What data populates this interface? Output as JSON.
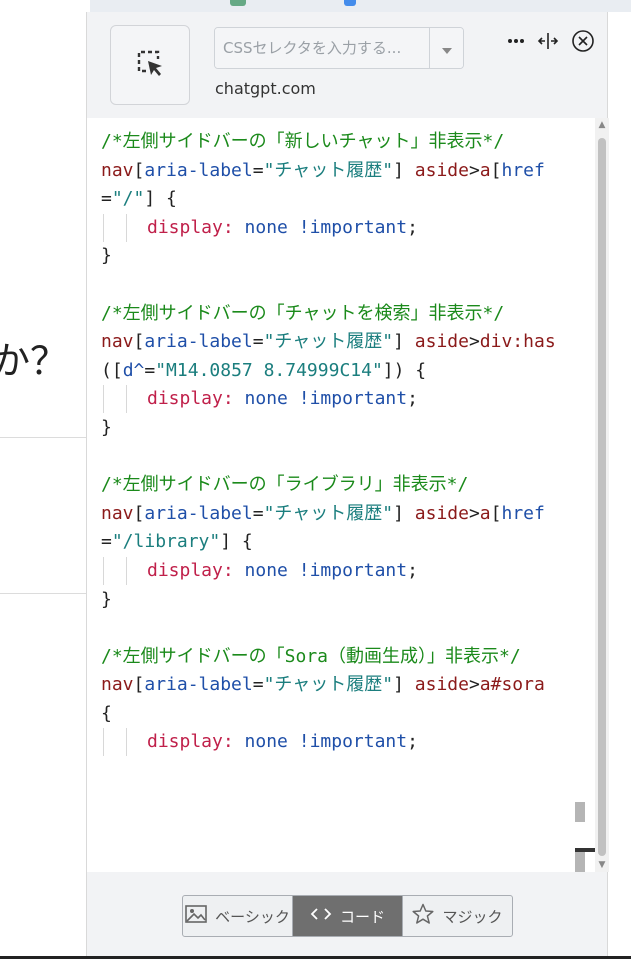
{
  "background": {
    "question_fragment": "か？"
  },
  "panel": {
    "selector_placeholder": "CSSセレクタを入力する...",
    "site": "chatgpt.com",
    "icons": [
      "element-picker-icon",
      "more-icon",
      "resize-icon",
      "close-icon",
      "dropdown-icon"
    ]
  },
  "code": [
    {
      "comment": "/*左側サイドバーの「新しいチャット」非表示*/"
    },
    {
      "selector": [
        [
          "nav",
          "sel"
        ],
        [
          "[",
          "p"
        ],
        [
          "aria-label",
          "attr"
        ],
        [
          "=",
          "p"
        ],
        [
          "\"チャット履歴\"",
          "str"
        ],
        [
          "] ",
          "p"
        ],
        [
          "aside",
          "sel"
        ],
        [
          ">",
          "p"
        ],
        [
          "a",
          "sel"
        ],
        [
          "[",
          "p"
        ],
        [
          "href",
          "attr"
        ],
        [
          "=",
          "p"
        ],
        [
          "\"/\"",
          "str"
        ],
        [
          "] {",
          "p"
        ]
      ]
    },
    {
      "decl": {
        "prop": "display:",
        "val": "none !important",
        "end": ";"
      }
    },
    {
      "close": "}"
    },
    {
      "blank": ""
    },
    {
      "comment": "/*左側サイドバーの「チャットを検索」非表示*/"
    },
    {
      "selector": [
        [
          "nav",
          "sel"
        ],
        [
          "[",
          "p"
        ],
        [
          "aria-label",
          "attr"
        ],
        [
          "=",
          "p"
        ],
        [
          "\"チャット履歴\"",
          "str"
        ],
        [
          "] ",
          "p"
        ],
        [
          "aside",
          "sel"
        ],
        [
          ">",
          "p"
        ],
        [
          "div:has",
          "sel"
        ],
        [
          "([",
          "p"
        ],
        [
          "d^",
          "attr"
        ],
        [
          "=",
          "p"
        ],
        [
          "\"M14.0857 8.74999C14\"",
          "str"
        ],
        [
          "]) {",
          "p"
        ]
      ]
    },
    {
      "decl": {
        "prop": "display:",
        "val": "none !important",
        "end": ";"
      }
    },
    {
      "close": "}"
    },
    {
      "blank": ""
    },
    {
      "comment": "/*左側サイドバーの「ライブラリ」非表示*/"
    },
    {
      "selector": [
        [
          "nav",
          "sel"
        ],
        [
          "[",
          "p"
        ],
        [
          "aria-label",
          "attr"
        ],
        [
          "=",
          "p"
        ],
        [
          "\"チャット履歴\"",
          "str"
        ],
        [
          "] ",
          "p"
        ],
        [
          "aside",
          "sel"
        ],
        [
          ">",
          "p"
        ],
        [
          "a",
          "sel"
        ],
        [
          "[",
          "p"
        ],
        [
          "href",
          "attr"
        ],
        [
          "=",
          "p"
        ],
        [
          "\"/library\"",
          "str"
        ],
        [
          "] {",
          "p"
        ]
      ]
    },
    {
      "decl": {
        "prop": "display:",
        "val": "none !important",
        "end": ";"
      }
    },
    {
      "close": "}"
    },
    {
      "blank": ""
    },
    {
      "comment": "/*左側サイドバーの「Sora（動画生成）」非表示*/"
    },
    {
      "selector": [
        [
          "nav",
          "sel"
        ],
        [
          "[",
          "p"
        ],
        [
          "aria-label",
          "attr"
        ],
        [
          "=",
          "p"
        ],
        [
          "\"チャット履歴\"",
          "str"
        ],
        [
          "] ",
          "p"
        ],
        [
          "aside",
          "sel"
        ],
        [
          ">",
          "p"
        ],
        [
          "a#sora",
          "sel"
        ],
        [
          " {",
          "p"
        ]
      ]
    },
    {
      "decl": {
        "prop": "display:",
        "val": "none !important",
        "end": ";"
      }
    }
  ],
  "modes": [
    {
      "label": "ベーシック",
      "icon": "image-icon",
      "active": false
    },
    {
      "label": "コード",
      "icon": "code-icon",
      "active": true
    },
    {
      "label": "マジック",
      "icon": "star-icon",
      "active": false
    }
  ]
}
